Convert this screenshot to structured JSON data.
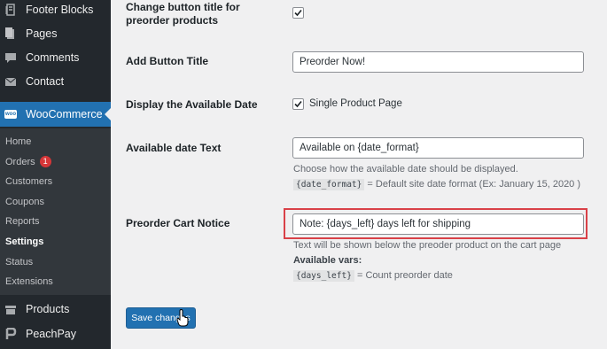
{
  "sidebar": {
    "top_items": [
      {
        "label": "Footer Blocks",
        "icon": "footer-blocks-icon"
      },
      {
        "label": "Pages",
        "icon": "pages-icon"
      },
      {
        "label": "Comments",
        "icon": "comments-icon"
      },
      {
        "label": "Contact",
        "icon": "mail-icon"
      }
    ],
    "active_item": {
      "label": "WooCommerce",
      "icon": "woocommerce-icon",
      "logo_text": "woo"
    },
    "submenu": [
      {
        "label": "Home"
      },
      {
        "label": "Orders",
        "badge": "1"
      },
      {
        "label": "Customers"
      },
      {
        "label": "Coupons"
      },
      {
        "label": "Reports"
      },
      {
        "label": "Settings",
        "current": true
      },
      {
        "label": "Status"
      },
      {
        "label": "Extensions"
      }
    ],
    "bottom_items": [
      {
        "label": "Products",
        "icon": "products-icon"
      },
      {
        "label": "PeachPay",
        "icon": "peachpay-icon"
      }
    ]
  },
  "form": {
    "change_button_title": {
      "label": "Change button title for preorder products",
      "checked": true
    },
    "add_button_title": {
      "label": "Add Button Title",
      "value": "Preorder Now!"
    },
    "display_available_date": {
      "label": "Display the Available Date",
      "checkbox_label": "Single Product Page",
      "checked": true
    },
    "available_date_text": {
      "label": "Available date Text",
      "value": "Available on {date_format}",
      "description": "Choose how the available date should be displayed.",
      "code": "{date_format}",
      "code_desc": "= Default site date format (Ex: January 15, 2020 )"
    },
    "preorder_cart_notice": {
      "label": "Preorder Cart Notice",
      "value": "Note:  {days_left} days left for shipping",
      "description": "Text will be shown below the preoder product on the cart page",
      "vars_title": "Available vars:",
      "code": "{days_left}",
      "code_desc": "= Count preorder date"
    }
  },
  "save_button": {
    "label": "Save changes"
  },
  "colors": {
    "sidebar_bg": "#23282d",
    "submenu_bg": "#32373c",
    "accent": "#2271b1",
    "highlight": "#d94148",
    "badge": "#d63638"
  }
}
